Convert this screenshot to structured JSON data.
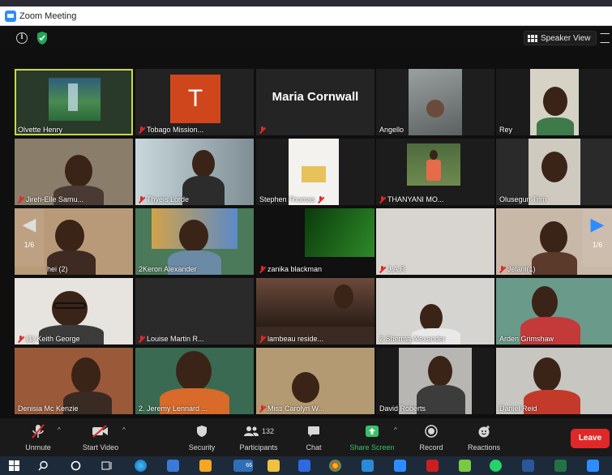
{
  "window": {
    "title": "Zoom Meeting"
  },
  "header": {
    "speaker_view_label": "Speaker View"
  },
  "pagination": {
    "left": "1/6",
    "right": "1/6"
  },
  "tiles": [
    {
      "name": "Olvette Henry",
      "muted": false
    },
    {
      "name": "Tobago Mission...",
      "muted": true,
      "avatar_letter": "T"
    },
    {
      "name": "",
      "muted": true,
      "display_name": "Maria Cornwall"
    },
    {
      "name": "Angello",
      "muted": false
    },
    {
      "name": "Rey",
      "muted": false
    },
    {
      "name": "Jireh-Elle Samu...",
      "muted": true
    },
    {
      "name": "Thyeis Lorde",
      "muted": true
    },
    {
      "name": "Stephen Thomas",
      "muted": true
    },
    {
      "name": "THANYANI MO...",
      "muted": true
    },
    {
      "name": "Olusegun Trim",
      "muted": false
    },
    {
      "name": "hei (2)",
      "muted": false
    },
    {
      "name": "2Keron Alexander",
      "muted": false
    },
    {
      "name": "zanika blackman",
      "muted": true
    },
    {
      "name": "J.A.R",
      "muted": true
    },
    {
      "name": "Jelani(1)",
      "muted": true
    },
    {
      "name": "(1) Keith George",
      "muted": true
    },
    {
      "name": "Louise Martin R...",
      "muted": true
    },
    {
      "name": "lambeau reside...",
      "muted": true
    },
    {
      "name": "2 Sherma Alexander",
      "muted": false
    },
    {
      "name": "Arden Grimshaw",
      "muted": false
    },
    {
      "name": "Denisia Mc Kenzie",
      "muted": false
    },
    {
      "name": "2. Jeremy Lennard ...",
      "muted": false
    },
    {
      "name": "Miss Carolyn W...",
      "muted": true
    },
    {
      "name": "David Roberts",
      "muted": false
    },
    {
      "name": "Daniel Reid",
      "muted": false
    }
  ],
  "toolbar": {
    "unmute": "Unmute",
    "start_video": "Start Video",
    "security": "Security",
    "participants": "Participants",
    "participant_count": "132",
    "chat": "Chat",
    "share_screen": "Share Screen",
    "record": "Record",
    "reactions": "Reactions",
    "leave": "Leave"
  },
  "taskbar": {
    "badge_count": "66"
  },
  "colors": {
    "accent": "#2d8cff",
    "share_green": "#38c266",
    "leave_red": "#e02828",
    "active_speaker": "#c8d84a"
  }
}
